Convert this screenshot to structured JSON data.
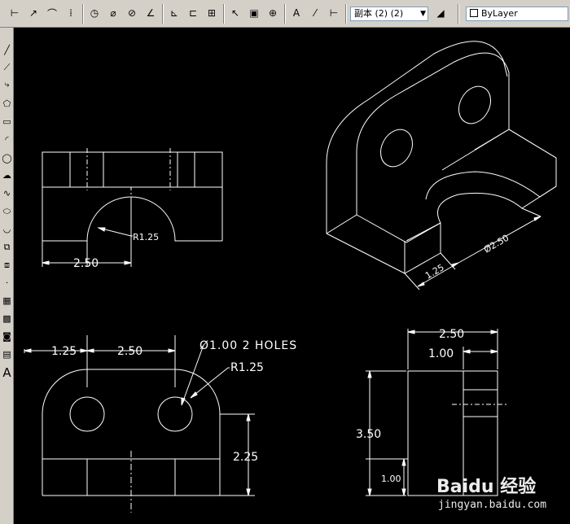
{
  "toolbar": {
    "style_select": "副本 (2) (2)",
    "layer_select": "ByLayer",
    "buttons": [
      "dim-linear",
      "dim-aligned",
      "dim-arc",
      "dim-ordinate",
      "dim-radius",
      "dim-jogged",
      "dim-diameter",
      "dim-angular",
      "dim-quick",
      "dim-baseline",
      "dim-continue",
      "leader",
      "tolerance",
      "center-mark",
      "dim-edit",
      "dim-text-edit",
      "dim-update",
      "dim-style"
    ]
  },
  "left_tools": [
    "line",
    "construction-line",
    "polyline",
    "polygon",
    "rectangle",
    "arc",
    "circle",
    "revision-cloud",
    "spline",
    "ellipse",
    "ellipse-arc",
    "insert-block",
    "make-block",
    "point",
    "hatch",
    "gradient",
    "region",
    "table",
    "multiline-text"
  ],
  "left_text_tool": "A",
  "drawing": {
    "top_view": {
      "radius": "R1.25",
      "width": "2.50"
    },
    "front_view": {
      "dim_left": "1.25",
      "dim_mid": "2.50",
      "holes_note": "Ø1.00 2 HOLES",
      "radius": "R1.25",
      "height": "2.25"
    },
    "side_view": {
      "width": "2.50",
      "slot": "1.00",
      "height": "3.50",
      "base": "1.00"
    },
    "iso_view": {
      "depth": "1.25",
      "diameter": "Ø2.50"
    }
  },
  "watermark": {
    "logo": "Baidu 经验",
    "url": "jingyan.baidu.com"
  }
}
